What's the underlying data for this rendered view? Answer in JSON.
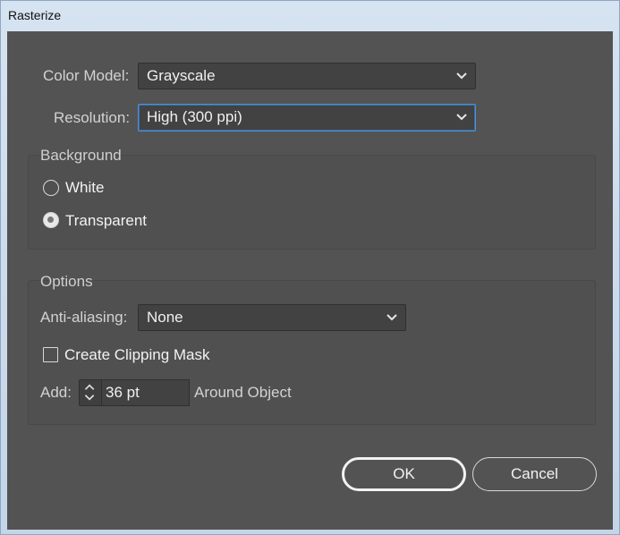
{
  "window": {
    "title": "Rasterize"
  },
  "color_model": {
    "label": "Color Model:",
    "value": "Grayscale"
  },
  "resolution": {
    "label": "Resolution:",
    "value": "High (300 ppi)"
  },
  "background": {
    "title": "Background",
    "options": [
      {
        "label": "White",
        "selected": false
      },
      {
        "label": "Transparent",
        "selected": true
      }
    ]
  },
  "options": {
    "title": "Options",
    "anti_aliasing": {
      "label": "Anti-aliasing:",
      "value": "None"
    },
    "clipping_mask": {
      "label": "Create Clipping Mask",
      "checked": false
    },
    "add": {
      "label": "Add:",
      "value": "36 pt",
      "suffix": "Around Object"
    }
  },
  "buttons": {
    "ok": "OK",
    "cancel": "Cancel"
  },
  "icons": {
    "dropdown": "chevron-down-icon",
    "stepper": "stepper-icon"
  }
}
